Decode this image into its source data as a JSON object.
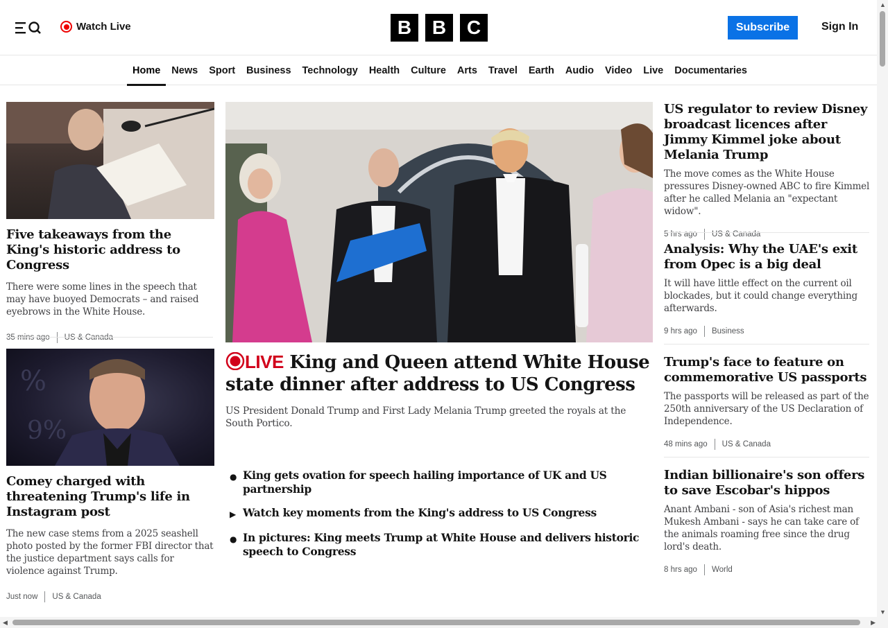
{
  "header": {
    "watch_live": "Watch Live",
    "logo_letters": [
      "B",
      "B",
      "C"
    ],
    "subscribe": "Subscribe",
    "sign_in": "Sign In"
  },
  "nav": {
    "items": [
      "Home",
      "News",
      "Sport",
      "Business",
      "Technology",
      "Health",
      "Culture",
      "Arts",
      "Travel",
      "Earth",
      "Audio",
      "Video",
      "Live",
      "Documentaries"
    ],
    "active": "Home"
  },
  "left": {
    "story1": {
      "headline": "Five takeaways from the King's historic address to Congress",
      "summary": "There were some lines in the speech that may have buoyed Democrats – and raised eyebrows in the White House.",
      "time": "35 mins ago",
      "category": "US & Canada"
    },
    "story2": {
      "headline": "Comey charged with threatening Trump's life in Instagram post",
      "summary": "The new case stems from a 2025 seashell photo posted by the former FBI director that the justice department says calls for violence against Trump.",
      "time": "Just now",
      "category": "US & Canada"
    }
  },
  "main": {
    "live_label": "LIVE",
    "headline": "King and Queen attend White House state dinner after address to US Congress",
    "summary": "US President Donald Trump and First Lady Melania Trump greeted the royals at the South Portico.",
    "bullets": [
      {
        "icon": "bullet",
        "text": "King gets ovation for speech hailing importance of UK and US partnership"
      },
      {
        "icon": "play",
        "text": "Watch key moments from the King's address to US Congress"
      },
      {
        "icon": "bullet",
        "text": "In pictures: King meets Trump at White House and delivers historic speech to Congress"
      }
    ]
  },
  "right": {
    "stories": [
      {
        "headline": "US regulator to review Disney broadcast licences after Jimmy Kimmel joke about Melania Trump",
        "summary": "The move comes as the White House pressures Disney-owned ABC to fire Kimmel after he called Melania an \"expectant widow\".",
        "time": "5 hrs ago",
        "category": "US & Canada"
      },
      {
        "headline": "Analysis: Why the UAE's exit from Opec is a big deal",
        "summary": "It will have little effect on the current oil blockades, but it could change everything afterwards.",
        "time": "9 hrs ago",
        "category": "Business"
      },
      {
        "headline": "Trump's face to feature on commemorative US passports",
        "summary": "The passports will be released as part of the 250th anniversary of the US Declaration of Independence.",
        "time": "48 mins ago",
        "category": "US & Canada"
      },
      {
        "headline": "Indian billionaire's son offers to save Escobar's hippos",
        "summary": "Anant Ambani - son of Asia's richest man Mukesh Ambani - says he can take care of the animals roaming free since the drug lord's death.",
        "time": "8 hrs ago",
        "category": "World"
      }
    ]
  },
  "colors": {
    "accent": "#0a72e6",
    "live": "#d1001a",
    "text": "#141414"
  }
}
